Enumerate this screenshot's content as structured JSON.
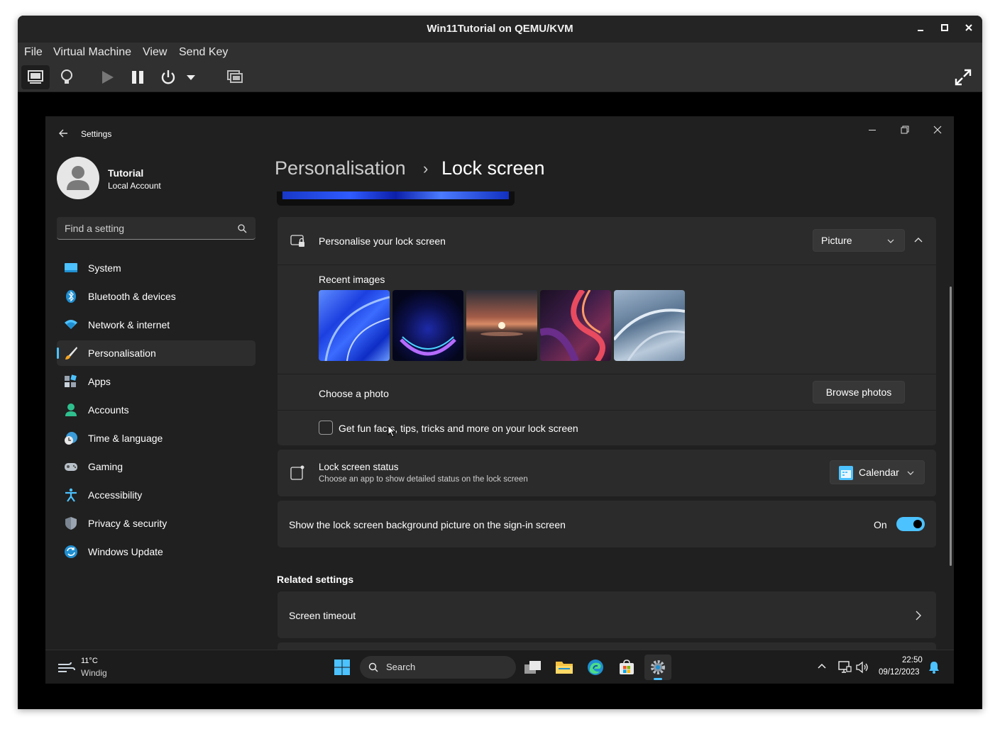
{
  "window": {
    "title": "Win11Tutorial on QEMU/KVM"
  },
  "menu": [
    "File",
    "Virtual Machine",
    "View",
    "Send Key"
  ],
  "settings": {
    "app_title": "Settings",
    "user": {
      "name": "Tutorial",
      "account": "Local Account"
    },
    "search_placeholder": "Find a setting",
    "nav": [
      {
        "label": "System",
        "icon": "system-icon"
      },
      {
        "label": "Bluetooth & devices",
        "icon": "bluetooth-icon"
      },
      {
        "label": "Network & internet",
        "icon": "wifi-icon"
      },
      {
        "label": "Personalisation",
        "icon": "brush-icon",
        "selected": true
      },
      {
        "label": "Apps",
        "icon": "apps-icon"
      },
      {
        "label": "Accounts",
        "icon": "accounts-icon"
      },
      {
        "label": "Time & language",
        "icon": "globe-clock-icon"
      },
      {
        "label": "Gaming",
        "icon": "gamepad-icon"
      },
      {
        "label": "Accessibility",
        "icon": "accessibility-icon"
      },
      {
        "label": "Privacy & security",
        "icon": "shield-icon"
      },
      {
        "label": "Windows Update",
        "icon": "update-icon"
      }
    ],
    "breadcrumb": {
      "parent": "Personalisation",
      "separator": "›",
      "current": "Lock screen"
    },
    "personalise": {
      "label": "Personalise your lock screen",
      "dropdown": "Picture"
    },
    "recent_images_label": "Recent images",
    "choose_photo": {
      "label": "Choose a photo",
      "button": "Browse photos"
    },
    "fun_facts": {
      "label": "Get fun facts, tips, tricks and more on your lock screen",
      "checked": false
    },
    "status": {
      "title": "Lock screen status",
      "subtitle": "Choose an app to show detailed status on the lock screen",
      "dropdown": "Calendar"
    },
    "signin_bg": {
      "label": "Show the lock screen background picture on the sign-in screen",
      "state": "On"
    },
    "related": {
      "heading": "Related settings",
      "item": "Screen timeout"
    }
  },
  "taskbar": {
    "weather": {
      "temp": "11°C",
      "desc": "Windig"
    },
    "search": "Search",
    "time": "22:50",
    "date": "09/12/2023"
  },
  "colors": {
    "accent": "#4cc2ff",
    "bg": "#202020",
    "card": "#2b2b2b"
  }
}
